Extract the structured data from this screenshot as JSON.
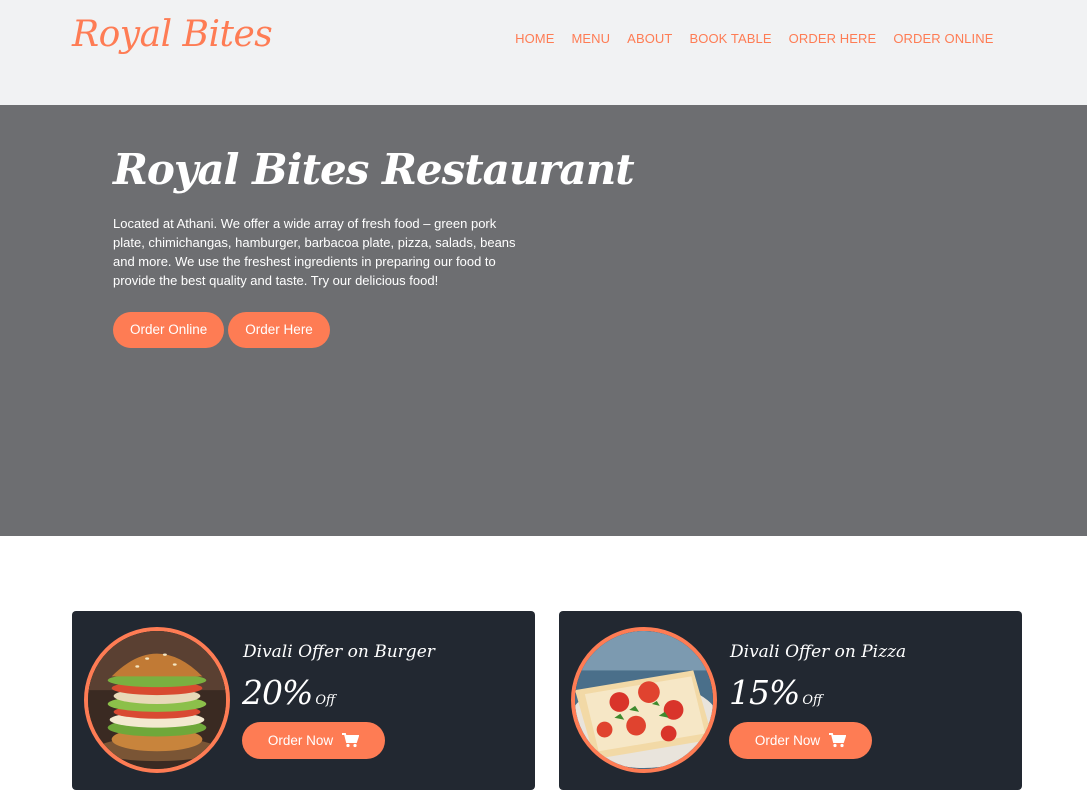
{
  "header": {
    "logo": "Royal Bites",
    "nav": [
      "HOME",
      "MENU",
      "ABOUT",
      "BOOK TABLE",
      "ORDER HERE",
      "ORDER ONLINE"
    ]
  },
  "hero": {
    "title": "Royal Bites Restaurant",
    "description": "Located at Athani. We offer a wide array of fresh food – green pork plate, chimichangas, hamburger, barbacoa plate, pizza, salads, beans and more. We use the freshest ingredients in preparing our food to provide the best quality and taste. Try our delicious food!",
    "buttons": [
      "Order Online",
      "Order Here"
    ]
  },
  "offers": [
    {
      "title": "Divali Offer on Burger",
      "percent": "20%",
      "off": "Off",
      "button": "Order Now",
      "image_icon": "burger-image"
    },
    {
      "title": "Divali Offer on Pizza",
      "percent": "15%",
      "off": "Off",
      "button": "Order Now",
      "image_icon": "pizza-image"
    }
  ],
  "colors": {
    "accent": "#fe7c54",
    "header_bg": "#f1f2f3",
    "hero_bg": "#6d6e71",
    "card_bg": "#222831"
  }
}
